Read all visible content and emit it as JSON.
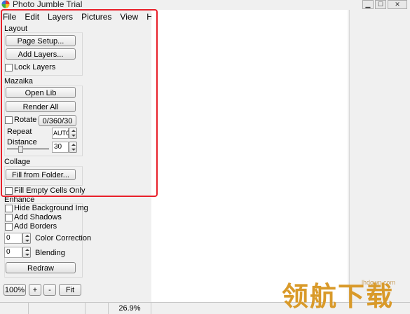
{
  "app": {
    "title": "Photo Jumble Trial"
  },
  "menu": [
    "File",
    "Edit",
    "Layers",
    "Pictures",
    "View",
    "Help"
  ],
  "layout": {
    "title": "Layout",
    "page_setup": "Page Setup...",
    "add_layers": "Add Layers...",
    "lock_layers": "Lock Layers"
  },
  "mazaika": {
    "title": "Mazaika",
    "open_lib": "Open Lib",
    "render_all": "Render All",
    "rotate": "Rotate",
    "rotate_btn": "0/360/30",
    "repeat": "Repeat",
    "repeat_value": "AUTO",
    "distance": "Distance",
    "distance_value": "30"
  },
  "collage": {
    "title": "Collage",
    "fill_from_folder": "Fill from Folder...",
    "fill_empty": "Fill Empty Cells Only"
  },
  "enhance": {
    "title": "Enhance",
    "hide_bg": "Hide Background Img",
    "add_shadows": "Add Shadows",
    "add_borders": "Add Borders",
    "color_correction_value": "0",
    "color_correction": "Color Correction",
    "blending_value": "0",
    "blending": "Blending",
    "redraw": "Redraw"
  },
  "zoom": {
    "zoom_100": "100%",
    "plus": "+",
    "minus": "-",
    "fit": "Fit"
  },
  "status": {
    "zoom_level": "26.9%"
  },
  "watermark": {
    "url": "lhdown.com",
    "text": "领航下载"
  }
}
